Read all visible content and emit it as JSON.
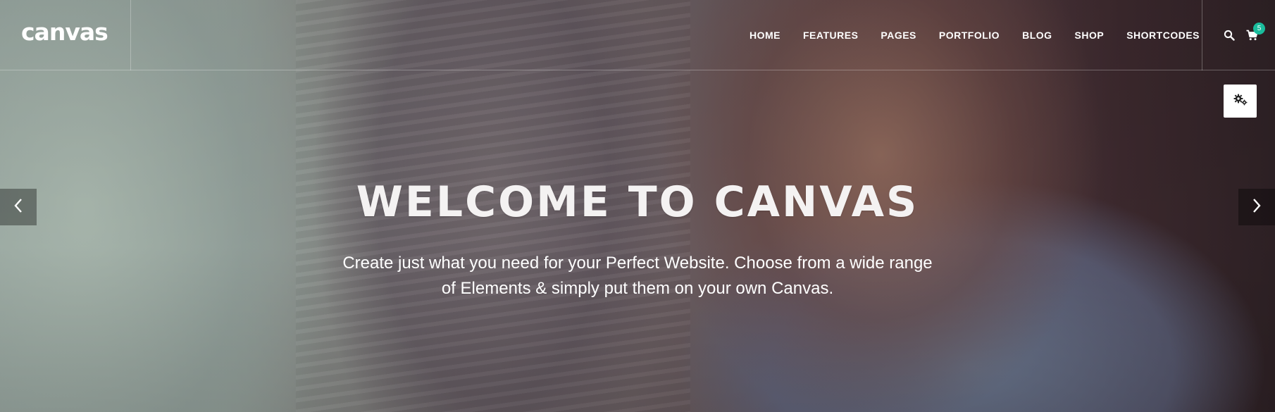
{
  "brand": {
    "logo_text": "canvas"
  },
  "nav": {
    "items": [
      {
        "label": "HOME"
      },
      {
        "label": "FEATURES"
      },
      {
        "label": "PAGES"
      },
      {
        "label": "PORTFOLIO"
      },
      {
        "label": "BLOG"
      },
      {
        "label": "SHOP"
      },
      {
        "label": "SHORTCODES"
      }
    ]
  },
  "header_icons": {
    "search": "search-icon",
    "cart": "cart-icon",
    "cart_count": "5"
  },
  "settings": {
    "icon": "gears-icon"
  },
  "slider": {
    "prev_icon": "chevron-left-icon",
    "next_icon": "chevron-right-icon"
  },
  "hero": {
    "title": "WELCOME TO CANVAS",
    "subtitle_line1": "Create just what you need for your Perfect Website. Choose from a wide range",
    "subtitle_line2": "of Elements & simply put them on your own Canvas."
  },
  "colors": {
    "accent": "#1abc9c",
    "text": "#ffffff"
  }
}
